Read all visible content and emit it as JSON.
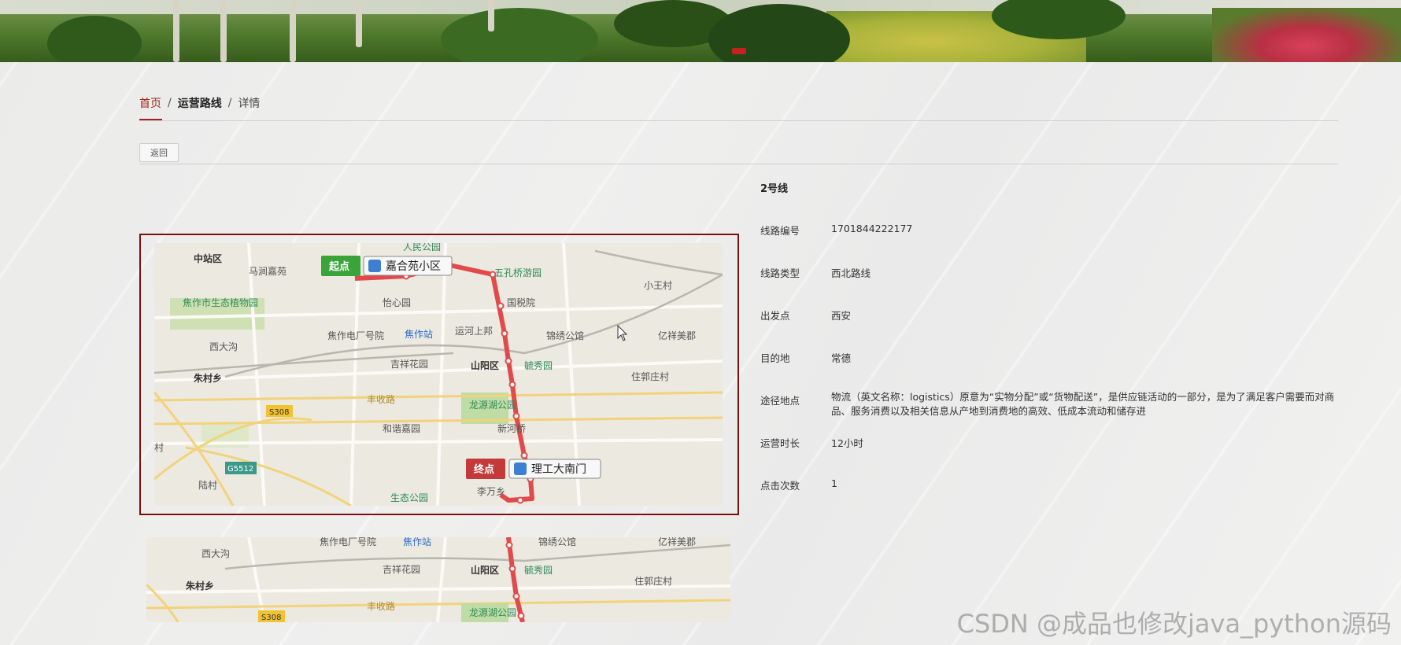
{
  "breadcrumb": {
    "home": "首页",
    "sep1": "/",
    "section": "运营路线",
    "sep2": "/",
    "current": "详情"
  },
  "back_button": "返回",
  "detail": {
    "title": "2号线",
    "rows": [
      {
        "label": "线路编号",
        "value": "1701844222177"
      },
      {
        "label": "线路类型",
        "value": "西北路线"
      },
      {
        "label": "出发点",
        "value": "西安"
      },
      {
        "label": "目的地",
        "value": "常德"
      },
      {
        "label": "途径地点",
        "value": "物流（英文名称：logistics）原意为“实物分配”或“货物配送”，是供应链活动的一部分，是为了满足客户需要而对商品、服务消费以及相关信息从产地到消费地的高效、低成本流动和储存进"
      },
      {
        "label": "运营时长",
        "value": "12小时"
      },
      {
        "label": "点击次数",
        "value": "1"
      }
    ]
  },
  "map": {
    "start_badge": "起点",
    "start_station": "嘉合苑小区",
    "end_badge": "终点",
    "end_station": "理工大南门",
    "labels": {
      "zhongzhan": "中站区",
      "majia": "马涧嘉苑",
      "renmin": "人民公园",
      "wuli": "五孔桥游园",
      "guoshui": "国税院",
      "xiaowang": "小王村",
      "jiaozuo_plant": "焦作市生态植物园",
      "yixin": "怡心园",
      "jiaozuo_dian": "焦作电厂号院",
      "jiaozuo_station": "焦作站",
      "yunhe": "运河上邦",
      "jinxiu": "锦绣公馆",
      "yixiang": "亿祥美郡",
      "xidagou": "西大沟",
      "jixiang": "吉祥花园",
      "shanyang": "山阳区",
      "xiuyuan": "毓秀园",
      "zhuguo": "住郭庄村",
      "zhucun": "朱村乡",
      "fengshou": "丰收路",
      "s308": "S308",
      "longyuan": "龙源湖公园",
      "hexie": "和谐嘉园",
      "xinhe": "新河桥",
      "g5512": "G5512",
      "lucun": "陆村",
      "shengtai": "生态公园",
      "liwan": "李万乡",
      "cun": "村"
    }
  },
  "watermark": "CSDN @成品也修改java_python源码",
  "colors": {
    "accent": "#a2261f",
    "route": "#e04a4a",
    "start": "#3aa43a",
    "end": "#c43a3a"
  }
}
